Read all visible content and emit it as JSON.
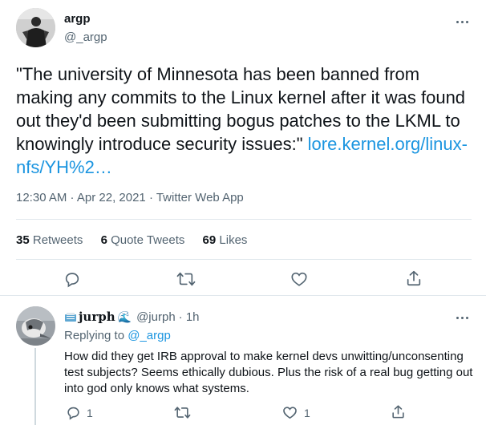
{
  "main_tweet": {
    "display_name": "argp",
    "handle": "@_argp",
    "text": "\"The university of Minnesota has been banned from making any commits to the Linux kernel after it was found out they'd been submitting bogus patches to the LKML to knowingly introduce security issues:\"",
    "link": "lore.kernel.org/linux-nfs/YH%2…",
    "timestamp": "12:30 AM · Apr 22, 2021 · Twitter Web App",
    "stats": {
      "retweets_count": "35",
      "retweets_label": "Retweets",
      "quote_count": "6",
      "quote_label": "Quote Tweets",
      "likes_count": "69",
      "likes_label": "Likes"
    }
  },
  "reply": {
    "display_name": "jurph",
    "name_emoji": "🌊",
    "handle": "@jurph",
    "time": "· 1h",
    "replying_prefix": "Replying to",
    "replying_handle": "@_argp",
    "text": "How did they get IRB approval to make kernel devs unwitting/unconsenting test subjects? Seems ethically dubious. Plus the risk of a real bug getting out into god only knows what systems.",
    "reply_count": "1",
    "like_count": "1"
  },
  "colors": {
    "link": "#1b95e0",
    "muted": "#536471",
    "text": "#0f1419",
    "divider": "#e1e8ed"
  },
  "icons": [
    "more-icon",
    "reply-icon",
    "retweet-icon",
    "like-icon",
    "share-icon"
  ]
}
